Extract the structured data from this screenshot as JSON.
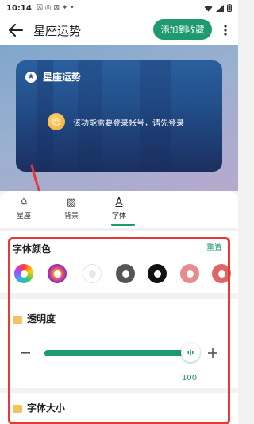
{
  "status_bar": {
    "time": "10:14",
    "misc": "☒ ◎ ⊠ ✦ •"
  },
  "app_bar": {
    "title": "星座运势",
    "favorite_button": "添加到收藏"
  },
  "widget": {
    "title": "星座运势",
    "message": "该功能需要登录帐号，请先登录"
  },
  "tabs": [
    {
      "label": "星座",
      "icon": "star-of-david-icon"
    },
    {
      "label": "背景",
      "icon": "background-pattern-icon"
    },
    {
      "label": "字体",
      "icon": "font-a-icon"
    }
  ],
  "font_color": {
    "title": "字体颜色",
    "reset_label": "重置",
    "swatches": [
      {
        "name": "rainbow",
        "color": "#c94de0"
      },
      {
        "name": "gradient-purple-orange",
        "color": "#7a2ad6"
      },
      {
        "name": "white",
        "color": "#ffffff"
      },
      {
        "name": "gray",
        "color": "#555555"
      },
      {
        "name": "black",
        "color": "#111111"
      },
      {
        "name": "pink",
        "color": "#e88b8b"
      },
      {
        "name": "red",
        "color": "#e06666"
      }
    ]
  },
  "opacity": {
    "title": "透明度",
    "value": "100",
    "level": 1.0
  },
  "font_size": {
    "title": "字体大小"
  },
  "colors": {
    "accent": "#1e9a6e",
    "highlight": "#e53935"
  }
}
